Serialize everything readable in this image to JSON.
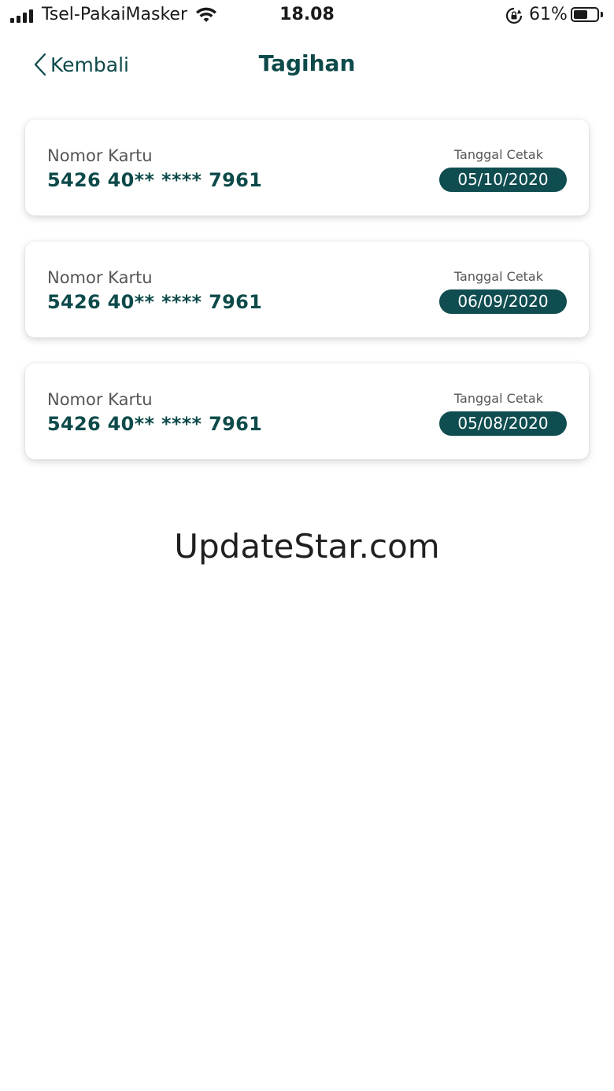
{
  "status_bar": {
    "carrier": "Tsel-PakaiMasker",
    "time": "18.08",
    "battery_percent": "61%",
    "battery_level": 0.61,
    "signal_bars": 4
  },
  "nav": {
    "back_label": "Kembali",
    "title": "Tagihan"
  },
  "cards": [
    {
      "label": "Nomor Kartu",
      "number": "5426 40** **** 7961",
      "date_label": "Tanggal Cetak",
      "date": "05/10/2020"
    },
    {
      "label": "Nomor Kartu",
      "number": "5426 40** **** 7961",
      "date_label": "Tanggal Cetak",
      "date": "06/09/2020"
    },
    {
      "label": "Nomor Kartu",
      "number": "5426 40** **** 7961",
      "date_label": "Tanggal Cetak",
      "date": "05/08/2020"
    }
  ],
  "watermark": "UpdateStar.com",
  "colors": {
    "accent": "#0e4a4a",
    "date_pill": "#0f4d50"
  }
}
